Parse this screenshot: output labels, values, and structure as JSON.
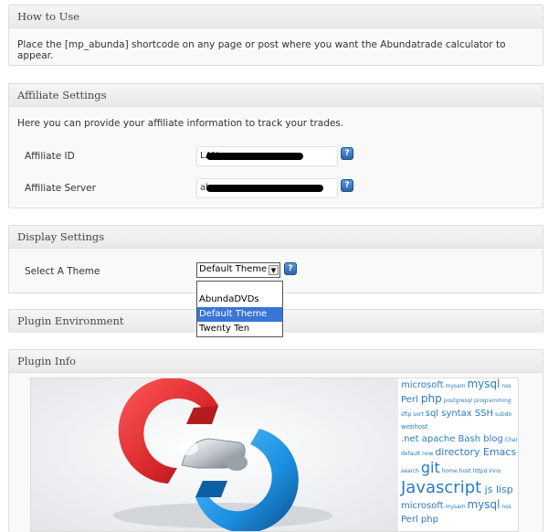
{
  "how_to_use": {
    "title": "How to Use",
    "text": "Place the [mp_abunda] shortcode on any page or post where you want the Abundatrade calculator to appear."
  },
  "affiliate": {
    "title": "Affiliate Settings",
    "intro": "Here you can provide your affiliate information to track your trades.",
    "id_label": "Affiliate ID",
    "id_value": "LAN",
    "server_label": "Affiliate Server",
    "server_value": "ab",
    "help_glyph": "?"
  },
  "display": {
    "title": "Display Settings",
    "theme_label": "Select A Theme",
    "selected_theme": "Default Theme",
    "options": [
      "AbundaDVDs",
      "Default Theme",
      "Twenty Ten"
    ],
    "help_glyph": "?"
  },
  "environment": {
    "title": "Plugin Environment"
  },
  "info": {
    "title": "Plugin Info",
    "cloud_lines": [
      [
        [
          "microsoft",
          10
        ],
        [
          " mysam ",
          6
        ],
        [
          "mysql",
          12
        ],
        [
          " nss",
          6
        ]
      ],
      [
        [
          "Perl ",
          10
        ],
        [
          "php",
          12
        ],
        [
          " postgresql programming",
          6
        ]
      ],
      [
        [
          "sftp sort ",
          6
        ],
        [
          "sql syntax SSH",
          10
        ],
        [
          " subdo",
          6
        ]
      ],
      [
        [
          "webhost",
          7
        ]
      ],
      [
        [
          ".net apache Bash blog",
          10
        ],
        [
          " Charl",
          6
        ]
      ],
      [
        [
          "default now ",
          6
        ],
        [
          "directory Emacs",
          11
        ]
      ],
      [
        [
          "search ",
          6
        ],
        [
          "git",
          16
        ],
        [
          " home host httpd inno",
          6
        ]
      ],
      [
        [
          "Javascript",
          18
        ],
        [
          " js lisp",
          11
        ]
      ],
      [
        [
          "microsoft",
          10
        ],
        [
          " mysam ",
          6
        ],
        [
          "mysql",
          12
        ],
        [
          " nss",
          6
        ]
      ],
      [
        [
          "Perl php",
          10
        ]
      ]
    ]
  },
  "colors": {
    "accent": "#2a7ac4",
    "selected": "#3875d7",
    "logo_red": "#d8262b",
    "logo_blue": "#1c8fe0"
  }
}
